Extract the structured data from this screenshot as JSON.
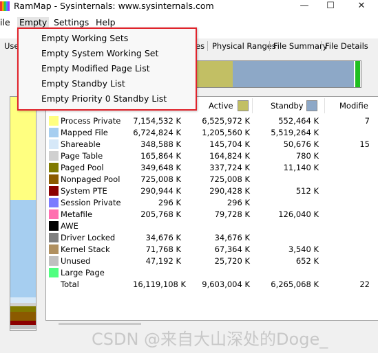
{
  "window": {
    "title": "RamMap - Sysinternals: www.sysinternals.com",
    "controls": {
      "minimize": "—",
      "maximize": "☐",
      "close": "✕"
    }
  },
  "menubar": {
    "file": "ile",
    "empty": "Empty",
    "settings": "Settings",
    "help": "Help"
  },
  "tabs": {
    "first": "Use",
    "hidden_tail": "es",
    "physical_ranges": "Physical Ranges",
    "file_summary": "File Summary",
    "file_details": "File Details"
  },
  "empty_menu": {
    "items": [
      "Empty Working Sets",
      "Empty System Working Set",
      "Empty Modified Page List",
      "Empty Standby List",
      "Empty Priority 0 Standby List"
    ]
  },
  "columns": {
    "active": "Active",
    "standby": "Standby",
    "modified": "Modifie"
  },
  "colors": {
    "active": "#c2bf64",
    "standby": "#8da8c7",
    "highlight": "#e0232b"
  },
  "rows": [
    {
      "label": "Process Private",
      "color": "#ffff80",
      "total": "7,154,532 K",
      "active": "6,525,972 K",
      "standby": "552,464 K",
      "modified": "7"
    },
    {
      "label": "Mapped File",
      "color": "#a6cef0",
      "total": "6,724,824 K",
      "active": "1,205,560 K",
      "standby": "5,519,264 K",
      "modified": ""
    },
    {
      "label": "Shareable",
      "color": "#d6e8f8",
      "total": "348,588 K",
      "active": "145,704 K",
      "standby": "50,676 K",
      "modified": "15"
    },
    {
      "label": "Page Table",
      "color": "#d0d0d0",
      "total": "165,864 K",
      "active": "164,824 K",
      "standby": "780 K",
      "modified": ""
    },
    {
      "label": "Paged Pool",
      "color": "#807a00",
      "total": "349,648 K",
      "active": "337,724 K",
      "standby": "11,140 K",
      "modified": ""
    },
    {
      "label": "Nonpaged Pool",
      "color": "#8b5a00",
      "total": "725,008 K",
      "active": "725,008 K",
      "standby": "",
      "modified": ""
    },
    {
      "label": "System PTE",
      "color": "#8b0000",
      "total": "290,944 K",
      "active": "290,428 K",
      "standby": "512 K",
      "modified": ""
    },
    {
      "label": "Session Private",
      "color": "#7b7bff",
      "total": "296 K",
      "active": "296 K",
      "standby": "",
      "modified": ""
    },
    {
      "label": "Metafile",
      "color": "#ff6fb0",
      "total": "205,768 K",
      "active": "79,728 K",
      "standby": "126,040 K",
      "modified": ""
    },
    {
      "label": "AWE",
      "color": "#000000",
      "total": "",
      "active": "",
      "standby": "",
      "modified": ""
    },
    {
      "label": "Driver Locked",
      "color": "#808080",
      "total": "34,676 K",
      "active": "34,676 K",
      "standby": "",
      "modified": ""
    },
    {
      "label": "Kernel Stack",
      "color": "#b09060",
      "total": "71,768 K",
      "active": "67,364 K",
      "standby": "3,540 K",
      "modified": ""
    },
    {
      "label": "Unused",
      "color": "#c0c0c0",
      "total": "47,192 K",
      "active": "25,720 K",
      "standby": "652 K",
      "modified": ""
    },
    {
      "label": "Large Page",
      "color": "#50ff80",
      "total": "",
      "active": "",
      "standby": "",
      "modified": ""
    },
    {
      "label": "Total",
      "color": "",
      "total": "16,119,108 K",
      "active": "9,603,004 K",
      "standby": "6,265,068 K",
      "modified": "22"
    }
  ],
  "watermark": "CSDN @来自大山深处的Doge_"
}
